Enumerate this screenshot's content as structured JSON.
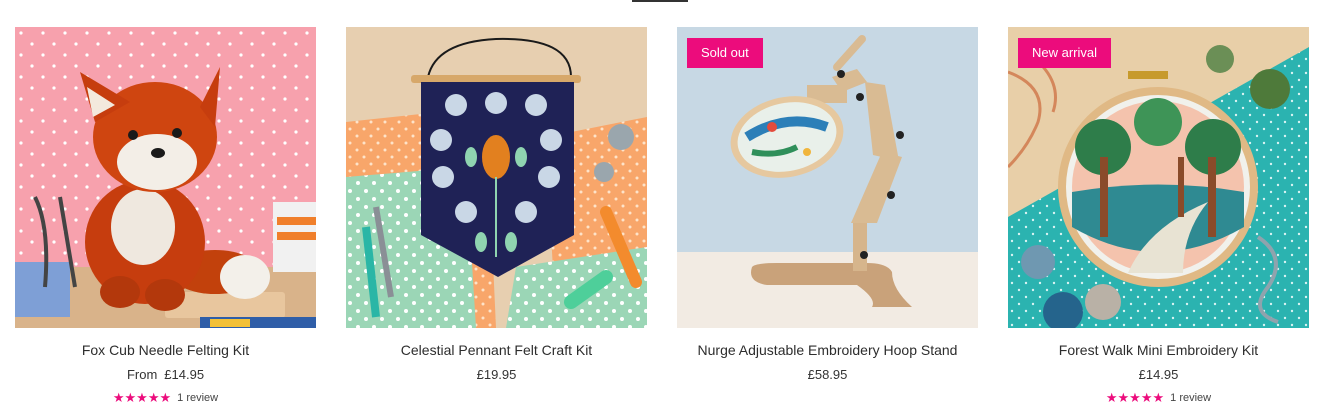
{
  "colors": {
    "badge": "#ec0c7c",
    "star": "#ec0c7c"
  },
  "products": [
    {
      "title": "Fox Cub Needle Felting Kit",
      "price_prefix": "From",
      "price": "£14.95",
      "badge": "",
      "rating_stars": "★★★★★",
      "rating": 5,
      "review_text": "1 review",
      "image_icon": "fox-felt-image"
    },
    {
      "title": "Celestial Pennant Felt Craft Kit",
      "price_prefix": "",
      "price": "£19.95",
      "badge": "",
      "rating_stars": "",
      "review_text": "",
      "image_icon": "pennant-image"
    },
    {
      "title": "Nurge Adjustable Embroidery Hoop Stand",
      "price_prefix": "",
      "price": "£58.95",
      "badge": "Sold out",
      "rating_stars": "",
      "review_text": "",
      "image_icon": "hoop-stand-image"
    },
    {
      "title": "Forest Walk Mini Embroidery Kit",
      "price_prefix": "",
      "price": "£14.95",
      "badge": "New arrival",
      "rating_stars": "★★★★★",
      "rating": 5,
      "review_text": "1 review",
      "image_icon": "forest-hoop-image"
    }
  ]
}
